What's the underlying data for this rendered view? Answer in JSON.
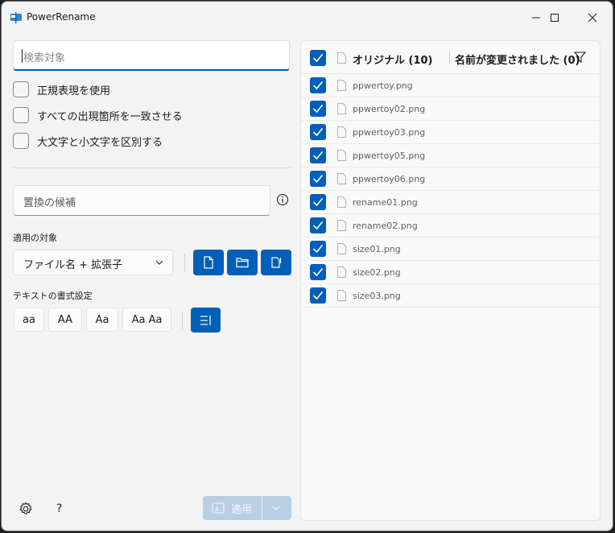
{
  "window": {
    "title": "PowerRename"
  },
  "search": {
    "placeholder": "検索対象"
  },
  "options": [
    {
      "label": "正規表現を使用"
    },
    {
      "label": "すべての出現箇所を一致させる"
    },
    {
      "label": "大文字と小文字を区別する"
    }
  ],
  "replace": {
    "placeholder": "置換の候補"
  },
  "apply_to": {
    "label": "適用の対象",
    "selected": "ファイル名 + 拡張子"
  },
  "text_format": {
    "label": "テキストの書式設定",
    "buttons": [
      "aa",
      "AA",
      "Aa",
      "Aa Aa"
    ]
  },
  "footer": {
    "help_label": "?",
    "apply_label": "適用"
  },
  "list": {
    "header_original": "オリジナル (10)",
    "header_renamed": "名前が変更されました (0)",
    "files": [
      "ppwertoy.png",
      "ppwertoy02.png",
      "ppwertoy03.png",
      "ppwertoy05.png",
      "ppwertoy06.png",
      "rename01.png",
      "rename02.png",
      "size01.png",
      "size02.png",
      "size03.png"
    ]
  },
  "colors": {
    "accent": "#005fb8",
    "apply_disabled": "#b9cfe4"
  }
}
